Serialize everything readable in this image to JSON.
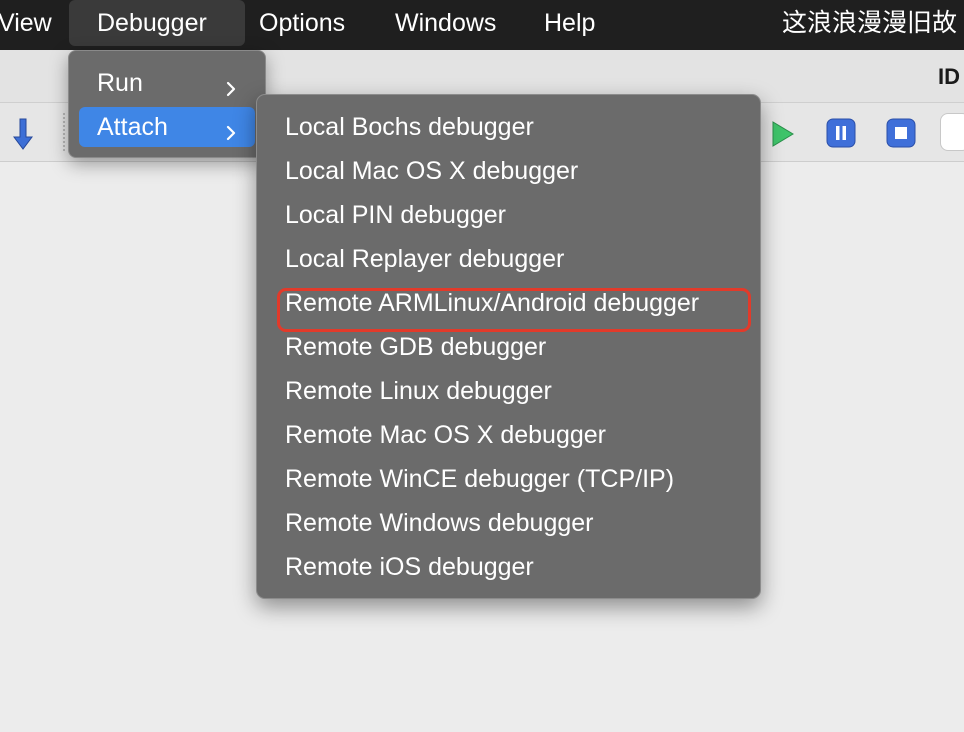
{
  "menubar": {
    "items": [
      "View",
      "Debugger",
      "Options",
      "Windows",
      "Help"
    ],
    "window_title": "这浪浪漫漫旧故"
  },
  "title_strip": {
    "app_abbrev": "ID"
  },
  "toolbar": {
    "icons": [
      "step-down-icon",
      "play-icon",
      "pause-icon",
      "stop-icon"
    ]
  },
  "debugger_menu": {
    "items": [
      {
        "label": "Run",
        "submenu": true,
        "selected": false
      },
      {
        "label": "Attach",
        "submenu": true,
        "selected": true
      }
    ]
  },
  "attach_submenu": {
    "items": [
      "Local Bochs debugger",
      "Local Mac OS X debugger",
      "Local PIN debugger",
      "Local Replayer debugger",
      "Remote ARMLinux/Android debugger",
      "Remote GDB debugger",
      "Remote Linux debugger",
      "Remote Mac OS X debugger",
      "Remote WinCE debugger (TCP/IP)",
      "Remote Windows debugger",
      "Remote iOS debugger"
    ],
    "highlighted_index": 4
  },
  "colors": {
    "menubar_bg": "#1f1f1f",
    "menu_bg": "#6b6b6b",
    "selection": "#3f86e6",
    "highlight_border": "#e23a2a"
  }
}
